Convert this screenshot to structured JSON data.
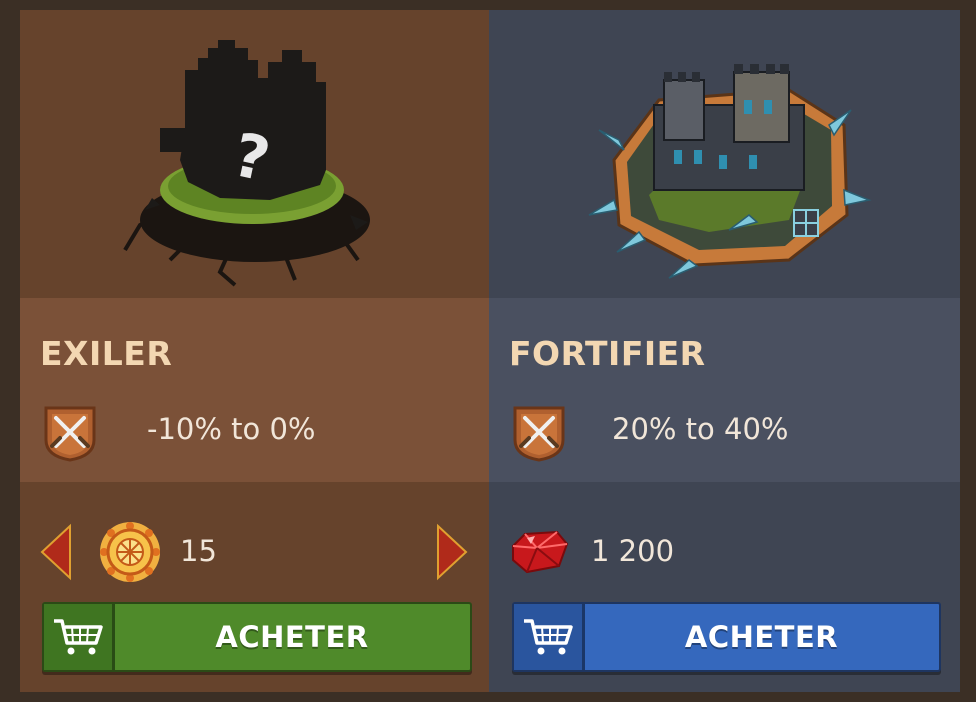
{
  "colors": {
    "left_panel_dark": "#66432c",
    "left_panel_light": "#7b5138",
    "right_panel_dark": "#3f4553",
    "right_panel_light": "#4a5060",
    "title_color": "#f3d7b2",
    "buy_green": "#4f8a2a",
    "buy_blue": "#3568bd"
  },
  "cards": [
    {
      "title": "EXILER",
      "image_icon": "mystery-castle-icon",
      "stat_icon": "crossed-swords-shield-icon",
      "stat_text": "-10% to 0%",
      "currency_icon": "gold-medallion-icon",
      "price": "15",
      "has_arrows": true,
      "buy_label": "ACHETER",
      "cart_icon": "shopping-cart-icon"
    },
    {
      "title": "FORTIFIER",
      "image_icon": "fortified-castle-icon",
      "stat_icon": "crossed-swords-shield-icon",
      "stat_text": "20% to 40%",
      "currency_icon": "ruby-gem-icon",
      "price": "1 200",
      "has_arrows": false,
      "buy_label": "ACHETER",
      "cart_icon": "shopping-cart-icon"
    }
  ]
}
